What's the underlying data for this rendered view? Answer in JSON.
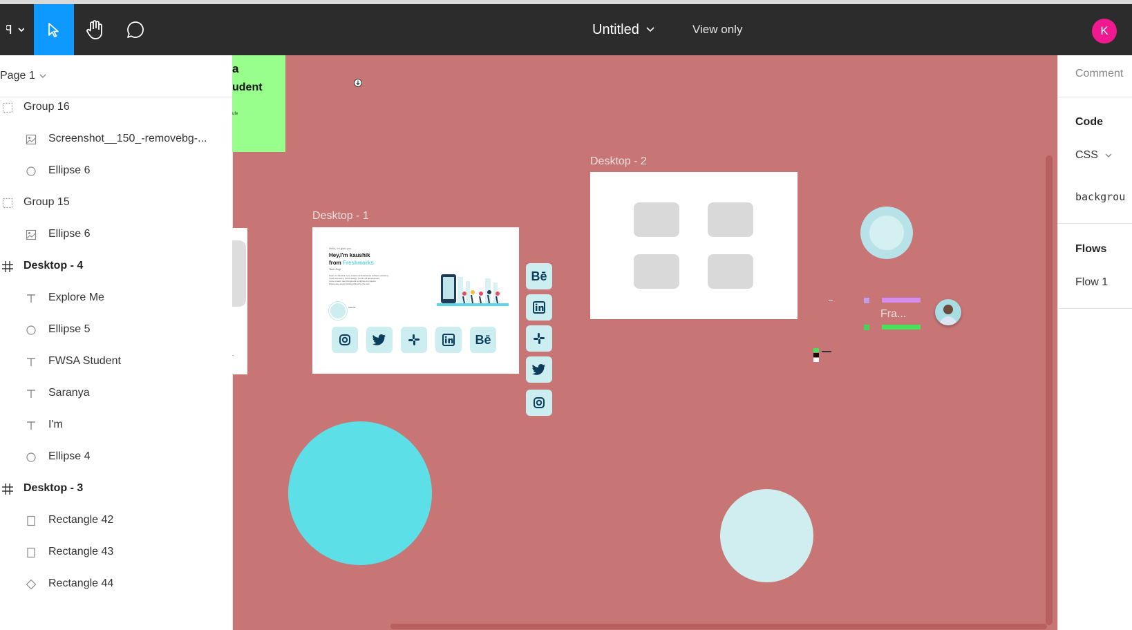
{
  "toolbar": {
    "menu_icon": "figma-logo",
    "file_title": "Untitled",
    "view_mode": "View only",
    "avatar_initial": "K",
    "accent": "#0d99ff",
    "avatar_color": "#f1198f"
  },
  "layers_panel": {
    "page": "Page 1",
    "items": [
      {
        "label": "Group 16",
        "type": "group",
        "indent": 0
      },
      {
        "label": "Screenshot__150_-removebg-...",
        "type": "image",
        "indent": 1
      },
      {
        "label": "Ellipse 6",
        "type": "ellipse",
        "indent": 1
      },
      {
        "label": "Group 15",
        "type": "group",
        "indent": 0
      },
      {
        "label": "Ellipse 6",
        "type": "image",
        "indent": 1
      },
      {
        "label": "Desktop - 4",
        "type": "frame",
        "indent": 0
      },
      {
        "label": "Explore Me",
        "type": "text",
        "indent": 1
      },
      {
        "label": "Ellipse 5",
        "type": "ellipse",
        "indent": 1
      },
      {
        "label": "FWSA Student",
        "type": "text",
        "indent": 1
      },
      {
        "label": "Saranya",
        "type": "text",
        "indent": 1
      },
      {
        "label": "I'm",
        "type": "text",
        "indent": 1
      },
      {
        "label": "Ellipse 4",
        "type": "ellipse",
        "indent": 1
      },
      {
        "label": "Desktop - 3",
        "type": "frame",
        "indent": 0
      },
      {
        "label": "Rectangle 42",
        "type": "rect",
        "indent": 1
      },
      {
        "label": "Rectangle 43",
        "type": "rect",
        "indent": 1
      },
      {
        "label": "Rectangle 44",
        "type": "diamond",
        "indent": 1
      }
    ]
  },
  "canvas": {
    "background": "#c87575",
    "green_card": {
      "line1": "a",
      "line2": "udent",
      "line3": "ufe"
    },
    "desktop1": {
      "label": "Desktop - 1",
      "small_intro": "Hello, Im glad you",
      "heading_line1": "Hey,I'm kaushik",
      "heading_line2_prefix": "from ",
      "heading_line2_brand": "Freshworks",
      "tagline": "Tech Guy",
      "body_lines": [
        "Hello, Im Kaushik, I am student of Freshworks software academy",
        "I have interest in UI/UX design, Front end development",
        "I love to learn new things and contribute to projects",
        "Passionate about building things for the web"
      ],
      "sig": "Kaushik"
    },
    "desktop2": {
      "label": "Desktop - 2"
    },
    "social_icons": [
      "Bē",
      "in",
      "slack",
      "twitter",
      "instagram"
    ],
    "right_mini": {
      "text": "Fra..."
    }
  },
  "right_panel": {
    "comment": "Comment",
    "code_heading": "Code",
    "css_label": "CSS",
    "background_prop": "backgrou",
    "flows_heading": "Flows",
    "flow_item": "Flow 1"
  }
}
